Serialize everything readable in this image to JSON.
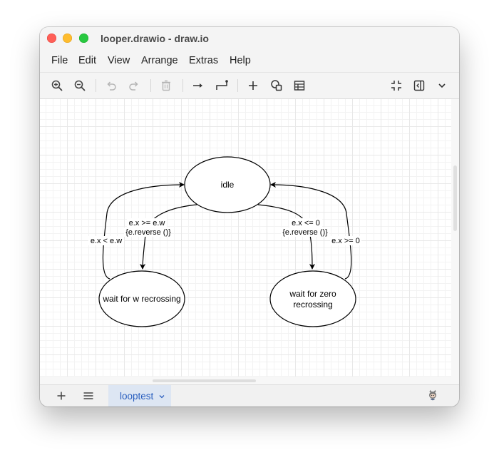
{
  "window": {
    "title": "looper.drawio - draw.io"
  },
  "menu": {
    "items": [
      "File",
      "Edit",
      "View",
      "Arrange",
      "Extras",
      "Help"
    ]
  },
  "toolbar": {
    "icons": [
      "zoom-in-icon",
      "zoom-out-icon",
      "undo-icon",
      "redo-icon",
      "delete-icon",
      "connection-arrow-icon",
      "waypoints-icon",
      "insert-plus-icon",
      "shapes-icon",
      "table-icon",
      "fullscreen-icon",
      "format-panel-icon",
      "chevron-down-icon"
    ]
  },
  "diagram": {
    "nodes": {
      "idle": "idle",
      "wait_w": "wait for w recrossing",
      "wait_zero_line1": "wait for zero",
      "wait_zero_line2": "recrossing"
    },
    "edges": {
      "idle_to_w_line1": "e.x >= e.w",
      "idle_to_w_line2": "{e.reverse ()}",
      "w_to_idle": "e.x < e.w",
      "idle_to_zero_line1": "e.x <= 0",
      "idle_to_zero_line2": "{e.reverse ()}",
      "zero_to_idle": "e.x >= 0"
    }
  },
  "footer": {
    "page_tab": "looptest"
  },
  "colors": {
    "accent": "#2a5fbf",
    "tab_bg": "#dde6f3"
  }
}
